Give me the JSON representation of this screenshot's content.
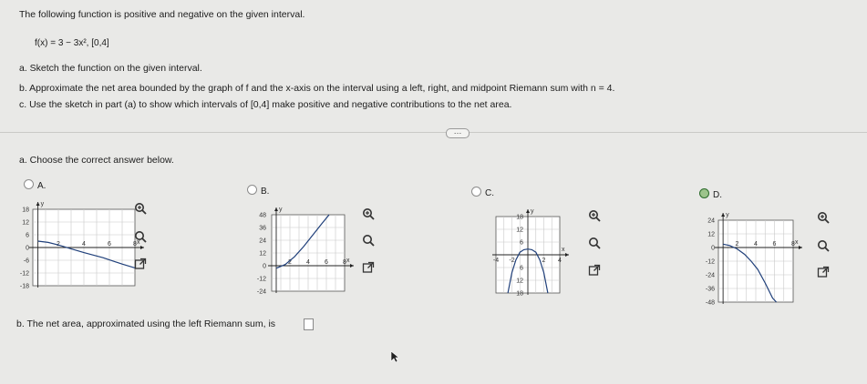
{
  "question": {
    "intro": "The following function is positive and negative on the given interval.",
    "function": "f(x) = 3 − 3x², [0,4]",
    "part_a": "a. Sketch the function on the given interval.",
    "part_b": "b. Approximate the net area bounded by the graph of f and the x-axis on the interval using a left, right, and midpoint Riemann sum with n = 4.",
    "part_c": "c. Use the sketch in part (a) to show which intervals of [0,4] make positive and negative contributions to the net area."
  },
  "more_button": "…",
  "prompt_a": "a. Choose the correct answer below.",
  "options": [
    {
      "letter": "A.",
      "selected": false,
      "y_ticks": [
        "18",
        "12",
        "6",
        "0",
        "-6",
        "-12",
        "-18"
      ],
      "x_ticks": [
        "2",
        "4",
        "6",
        "8"
      ],
      "x_label": "x",
      "y_label": "y"
    },
    {
      "letter": "B.",
      "selected": false,
      "y_ticks": [
        "48",
        "36",
        "24",
        "12",
        "0",
        "-12",
        "-24"
      ],
      "x_ticks": [
        "2",
        "4",
        "6",
        "8"
      ],
      "x_label": "x",
      "y_label": "y"
    },
    {
      "letter": "C.",
      "selected": false,
      "y_ticks": [
        "18",
        "12",
        "6",
        "6",
        "12",
        "18"
      ],
      "x_ticks": [
        "-4",
        "-2",
        "2",
        "4"
      ],
      "x_label": "x",
      "y_label": "y"
    },
    {
      "letter": "D.",
      "selected": true,
      "y_ticks": [
        "24",
        "12",
        "0",
        "-12",
        "-24",
        "-36",
        "-48"
      ],
      "x_ticks": [
        "2",
        "4",
        "6",
        "8"
      ],
      "x_label": "x",
      "y_label": "y"
    }
  ],
  "part_b_answer": {
    "prompt": "b. The net area, approximated using the left Riemann sum, is",
    "value": ""
  },
  "colors": {
    "selected_radio": "#9dc48c",
    "background": "#e9e9e7"
  }
}
